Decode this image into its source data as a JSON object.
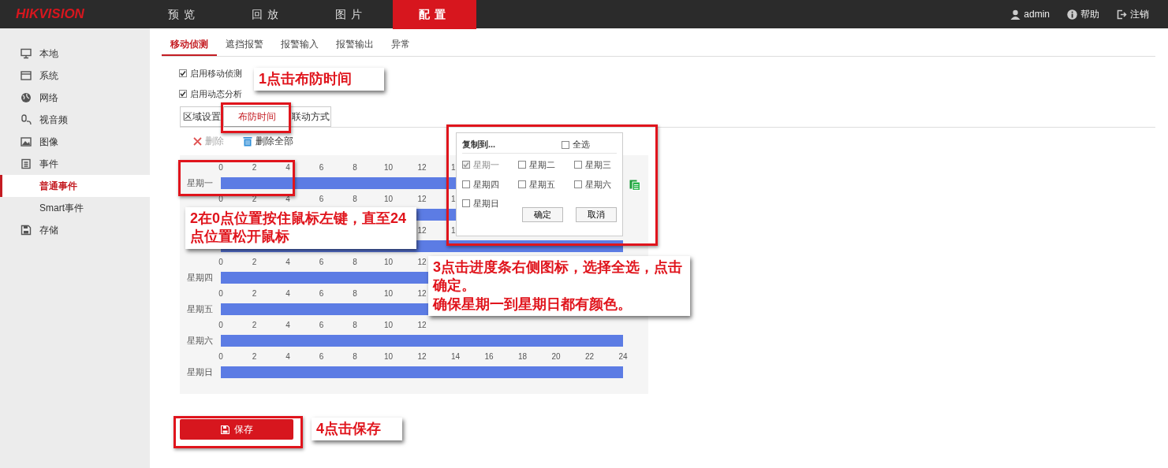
{
  "header": {
    "logo": "HIKVISION",
    "nav": [
      {
        "label": "预览",
        "selected": false
      },
      {
        "label": "回放",
        "selected": false
      },
      {
        "label": "图片",
        "selected": false
      },
      {
        "label": "配置",
        "selected": true
      }
    ],
    "user": "admin",
    "help": "帮助",
    "logout": "注销"
  },
  "sidebar": {
    "items": [
      {
        "label": "本地",
        "selected": false
      },
      {
        "label": "系统",
        "selected": false
      },
      {
        "label": "网络",
        "selected": false
      },
      {
        "label": "视音频",
        "selected": false
      },
      {
        "label": "图像",
        "selected": false
      },
      {
        "label": "事件",
        "selected": false,
        "children": [
          {
            "label": "普通事件",
            "selected": true
          },
          {
            "label": "Smart事件",
            "selected": false
          }
        ]
      },
      {
        "label": "存储",
        "selected": false
      }
    ]
  },
  "subtabs": [
    {
      "label": "移动侦测",
      "selected": true
    },
    {
      "label": "遮挡报警",
      "selected": false
    },
    {
      "label": "报警输入",
      "selected": false
    },
    {
      "label": "报警输出",
      "selected": false
    },
    {
      "label": "异常",
      "selected": false
    }
  ],
  "options": [
    {
      "label": "启用移动侦测",
      "checked": true
    },
    {
      "label": "启用动态分析",
      "checked": true
    }
  ],
  "steps": [
    {
      "label": "区域设置",
      "selected": false
    },
    {
      "label": "布防时间",
      "selected": true
    },
    {
      "label": "联动方式",
      "selected": false
    }
  ],
  "toolbar": [
    {
      "label": "删除",
      "disabled": true
    },
    {
      "label": "删除全部",
      "disabled": false
    }
  ],
  "schedule": {
    "rows": [
      {
        "kind": "full",
        "label": "星期一",
        "ticks": [
          "0",
          "2",
          "4",
          "6",
          "8",
          "10",
          "12"
        ],
        "cut_tick": "1",
        "level": 1
      },
      {
        "kind": "full",
        "ticks": [
          "0",
          "2",
          "4",
          "6",
          "8",
          "10",
          "12"
        ],
        "cut_tick": "1",
        "level": 1
      },
      {
        "kind": "tail",
        "ticks": [
          "12"
        ],
        "cut_tick": "1",
        "level": 1
      },
      {
        "kind": "full",
        "label": "星期四",
        "ticks": [
          "0",
          "2",
          "4",
          "6",
          "8",
          "10",
          "12"
        ],
        "level": 1
      },
      {
        "kind": "full",
        "label": "星期五",
        "ticks": [
          "0",
          "2",
          "4",
          "6",
          "8",
          "10",
          "12"
        ],
        "level": 1
      },
      {
        "kind": "full",
        "label": "星期六",
        "ticks": [
          "0",
          "2",
          "4",
          "6",
          "8",
          "10",
          "12"
        ],
        "level": 1
      },
      {
        "kind": "full",
        "label": "星期日",
        "ticks": [
          "0",
          "2",
          "4",
          "6",
          "8",
          "10",
          "12",
          "14",
          "16",
          "18",
          "20",
          "22",
          "24"
        ],
        "level": 1
      }
    ]
  },
  "copy_dialog": {
    "title": "复制到...",
    "select_all": {
      "label": "全选",
      "checked": false
    },
    "days": [
      {
        "label": "星期一",
        "checked": true,
        "disabled": true
      },
      {
        "label": "星期二",
        "checked": false,
        "disabled": false
      },
      {
        "label": "星期三",
        "checked": false,
        "disabled": false
      },
      {
        "label": "星期四",
        "checked": false,
        "disabled": false
      },
      {
        "label": "星期五",
        "checked": false,
        "disabled": false
      },
      {
        "label": "星期六",
        "checked": false,
        "disabled": false
      },
      {
        "label": "星期日",
        "checked": false,
        "disabled": false
      }
    ],
    "buttons": [
      "确定",
      "取消"
    ]
  },
  "save_button": "保存",
  "callouts": [
    {
      "paragraphs": [
        "1点击布防时间"
      ]
    },
    {
      "paragraphs": [
        "2在0点位置按住鼠标左键，直至24点位置松开鼠标"
      ]
    },
    {
      "paragraphs": [
        "3点击进度条右侧图标，选择全选，点击确定。",
        "确保星期一到星期日都有颜色。"
      ]
    },
    {
      "paragraphs": [
        "4点击保存"
      ]
    }
  ]
}
